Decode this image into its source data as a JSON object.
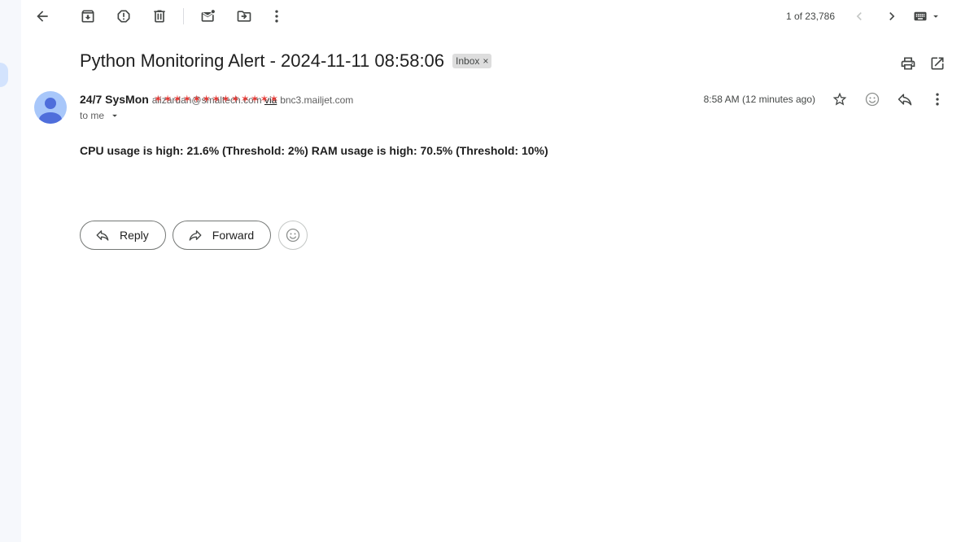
{
  "toolbar": {
    "back_icon": "arrow-left-icon",
    "archive_icon": "archive-icon",
    "spam_icon": "report-spam-icon",
    "delete_icon": "trash-icon",
    "mark_unread_icon": "mark-unread-icon",
    "move_icon": "move-to-folder-icon",
    "more_icon": "more-vertical-icon",
    "counter": "1 of 23,786",
    "prev_icon": "chevron-left-icon",
    "next_icon": "chevron-right-icon",
    "keyboard_icon": "keyboard-icon"
  },
  "email": {
    "subject": "Python Monitoring Alert - 2024-11-11 08:58:06",
    "label": "Inbox",
    "label_remove": "×",
    "sender_name": "24/7 SysMon",
    "sender_email": "alizardan@smaltech.com",
    "via_text": "via",
    "via_domain": "bnc3.mailjet.com",
    "recipient": "to me",
    "timestamp": "8:58 AM (12 minutes ago)",
    "body": "CPU usage is high: 21.6% (Threshold: 2%) RAM usage is high: 70.5% (Threshold: 10%)"
  },
  "actions": {
    "reply_label": "Reply",
    "forward_label": "Forward"
  },
  "colors": {
    "avatar_bg": "#a8c7fa",
    "avatar_fg": "#4f6edb",
    "redaction": "#e53935",
    "rail_bg": "#f6f8fc"
  }
}
